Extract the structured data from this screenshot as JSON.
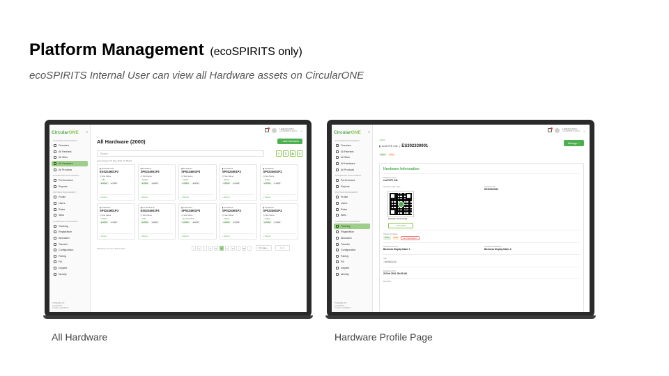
{
  "slide": {
    "title": "Platform Management",
    "title_note": "(ecoSPIRITS only)",
    "subtitle": "ecoSPIRITS Internal User can view all Hardware assets on CircularONE",
    "caption_left": "All Hardware",
    "caption_right": "Hardware Profile Page"
  },
  "app": {
    "logo_a": "Circular",
    "logo_b": "ONE",
    "collapse": "«",
    "user_name": "Leigh Ann Gom...",
    "user_role": "ecoSPIRITS admin",
    "chevron": "⌄"
  },
  "sidebar": {
    "sections": [
      {
        "label": "Platform Management",
        "items": [
          "Overview",
          "All Partners",
          "All Sites",
          "All Hardware",
          "All Products"
        ]
      },
      {
        "label": "Dashboard Management",
        "items": [
          "Performance",
          "Reports"
        ]
      },
      {
        "label": "Partner Management",
        "items": [
          "Profile",
          "Users",
          "Roles",
          "Sites"
        ]
      },
      {
        "label": "Hardware Management",
        "items": [
          "Tracking",
          "Registration",
          "Allocation",
          "Transfer",
          "Configuration",
          "Pairing",
          "Fill",
          "Deplete",
          "Identify"
        ]
      }
    ],
    "footer": [
      "POWERED BY",
      "ecoSPIRITS",
      "© 2024 ecoSPIRITS"
    ]
  },
  "hardware_list": {
    "title": "All Hardware (2000)",
    "add_button": "+ Add Hardware",
    "search_placeholder": "Search",
    "last_updated": "Last Updated 27 May 2024, 10:35AM",
    "report_label": "+ Report",
    "cards": [
      {
        "brand": "ecoTOTE 4.5L",
        "serial": "ES0224601P3",
        "line1": "Site Name",
        "line2": "4.5L",
        "tags": [
          "Active",
          "Good"
        ]
      },
      {
        "brand": "SmartPour",
        "serial": "SP0224601P3",
        "line1": "Site Name",
        "line2": "Online",
        "tags": [
          "Active",
          "Good"
        ]
      },
      {
        "brand": "SmartPour",
        "serial": "SP0224601P3",
        "line1": "Site Name",
        "line2": "Online",
        "tags": [
          "Active",
          "Good"
        ]
      },
      {
        "brand": "SmartPour",
        "serial": "SP0224601P3",
        "line1": "Site Name",
        "line2": "Online",
        "tags": [
          "Active",
          "Good"
        ]
      },
      {
        "brand": "SmartPour",
        "serial": "SP0224601P3",
        "line1": "Site Name",
        "line2": "Online",
        "tags": [
          "Active",
          "Good"
        ]
      },
      {
        "brand": "SmartPour",
        "serial": "SP0224601P3",
        "line1": "Site Name",
        "line2": "Online",
        "tags": [
          "Active",
          "Good"
        ]
      },
      {
        "brand": "ecoTOTE 4.5L",
        "serial": "ES0224601P3",
        "line1": "Site Name",
        "line2": "4.5L",
        "tags": [
          "Active",
          "Good"
        ]
      },
      {
        "brand": "ecoPLANT",
        "serial": "SP0224601P3",
        "line1": "Site Name",
        "line2": "30 Jun 2024",
        "tags": [
          "Active",
          "Good"
        ]
      },
      {
        "brand": "SmartPour",
        "serial": "SP0224601P3",
        "line1": "Site Name",
        "line2": "Online",
        "tags": [
          "Active",
          "Good"
        ]
      },
      {
        "brand": "SmartPour",
        "serial": "SP0224601P3",
        "line1": "Site Name",
        "line2": "Online",
        "tags": [
          "Active",
          "Good"
        ]
      }
    ],
    "showing": "Showing 1 to 10 of 100 entries",
    "pages": [
      "‹",
      "1",
      "...",
      "4",
      "5",
      "6",
      "7",
      "8",
      "...",
      "10",
      "›"
    ],
    "active_page": "6",
    "per_page": "10 / page ⌄",
    "goto": "Go to"
  },
  "hardware_profile": {
    "back": "‹ Back",
    "type_label": "ecoTOTE 4.5L",
    "serial": "ES302330001",
    "tags": [
      "Active",
      "Faulty"
    ],
    "manage_button": "Manage ⌄",
    "panel_title": "Hardware Information",
    "hardware_type_label": "Hardware Type",
    "hardware_type_value": "ecoTOTE 4.5L",
    "qr_label": "Hardware QR Code",
    "hardware_id_label": "Hardware ID",
    "hardware_id_value": "ES302330001",
    "qr_caption": "[Hardware Serial Code]",
    "download": "⤓ Download",
    "status_label": "Status/Condition",
    "status_tags": [
      "Active",
      "Faulty"
    ],
    "fault_tag": "Go to Fault Report ›",
    "owner_label": "Hardware Owner",
    "owner_value": "Business Display Name 1",
    "allocation_label": "Hardware Allocation",
    "allocation_value": "Business Display Name 2",
    "site_label": "Site",
    "site_value": "Site Name 1A",
    "registered_label": "Registered On",
    "registered_value": "26 Feb 2024, 08:45 AM",
    "remarks_label": "Remarks"
  }
}
